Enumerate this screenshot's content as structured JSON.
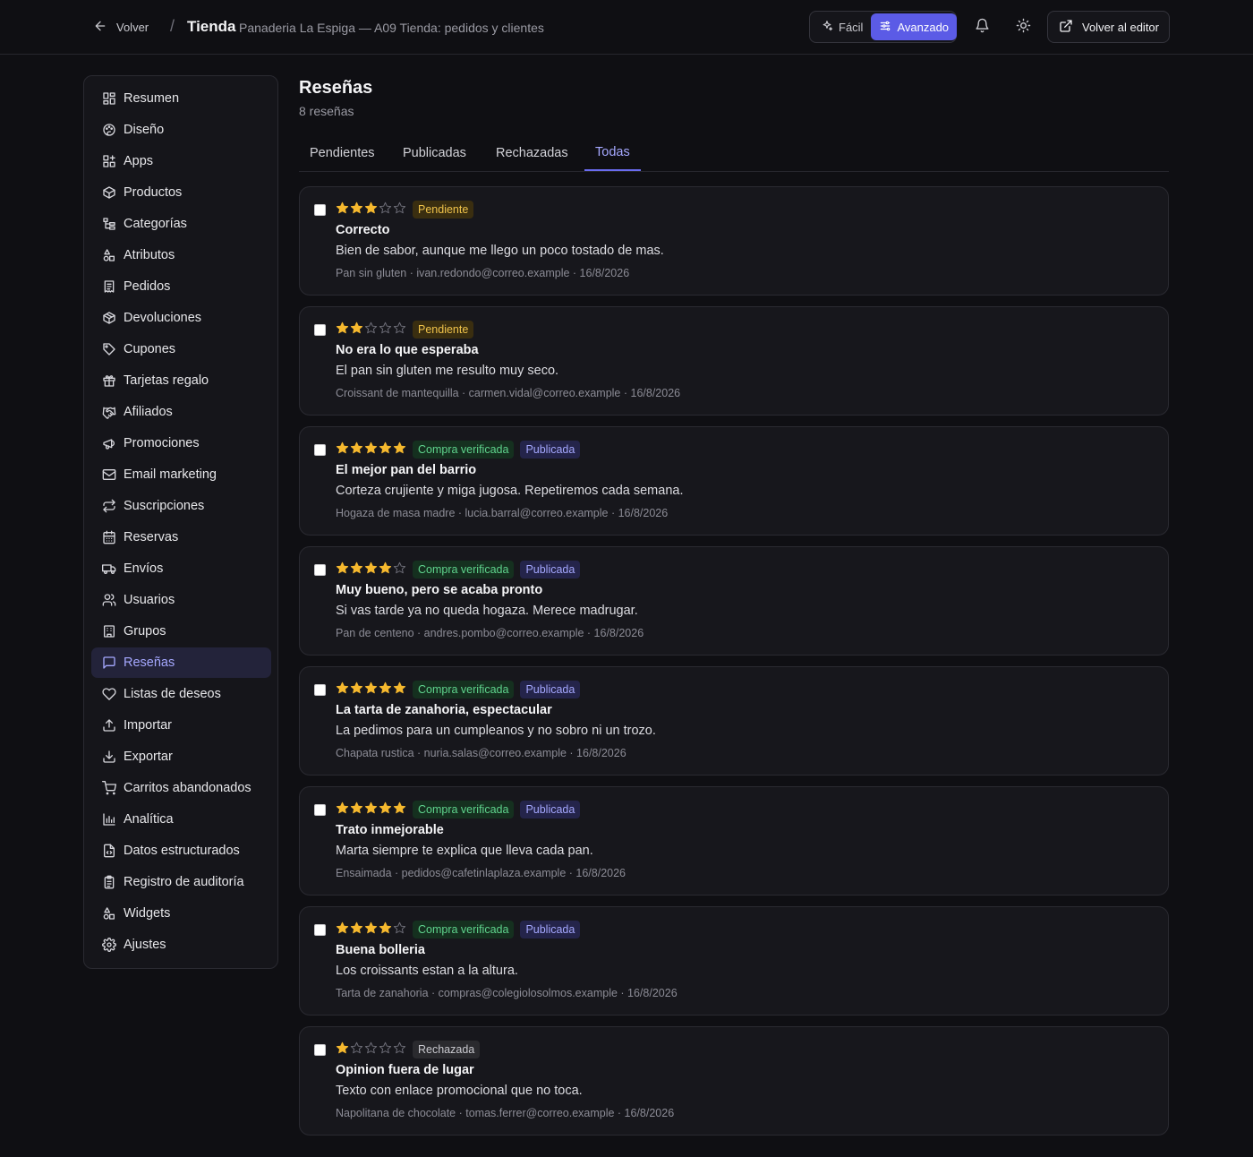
{
  "header": {
    "back_label": "Volver",
    "separator": "/",
    "title": "Tienda",
    "subtitle": "Panaderia La Espiga — A09 Tienda: pedidos y clientes",
    "mode_easy": "Fácil",
    "mode_advanced": "Avanzado",
    "editor_label": "Volver al editor"
  },
  "sidebar": {
    "items": [
      {
        "label": "Resumen",
        "icon": "grid-icon"
      },
      {
        "label": "Diseño",
        "icon": "palette-icon"
      },
      {
        "label": "Apps",
        "icon": "apps-icon"
      },
      {
        "label": "Productos",
        "icon": "box-icon"
      },
      {
        "label": "Categorías",
        "icon": "tree-icon"
      },
      {
        "label": "Atributos",
        "icon": "shapes-icon"
      },
      {
        "label": "Pedidos",
        "icon": "receipt-icon"
      },
      {
        "label": "Devoluciones",
        "icon": "box-return-icon"
      },
      {
        "label": "Cupones",
        "icon": "tag-icon"
      },
      {
        "label": "Tarjetas regalo",
        "icon": "gift-icon"
      },
      {
        "label": "Afiliados",
        "icon": "handshake-icon"
      },
      {
        "label": "Promociones",
        "icon": "megaphone-icon"
      },
      {
        "label": "Email marketing",
        "icon": "mail-icon"
      },
      {
        "label": "Suscripciones",
        "icon": "repeat-icon"
      },
      {
        "label": "Reservas",
        "icon": "calendar-icon"
      },
      {
        "label": "Envíos",
        "icon": "truck-icon"
      },
      {
        "label": "Usuarios",
        "icon": "users-icon"
      },
      {
        "label": "Grupos",
        "icon": "building-icon"
      },
      {
        "label": "Reseñas",
        "icon": "message-icon",
        "active": true
      },
      {
        "label": "Listas de deseos",
        "icon": "heart-icon"
      },
      {
        "label": "Importar",
        "icon": "upload-icon"
      },
      {
        "label": "Exportar",
        "icon": "download-icon"
      },
      {
        "label": "Carritos abandonados",
        "icon": "cart-icon"
      },
      {
        "label": "Analítica",
        "icon": "bar-chart-icon"
      },
      {
        "label": "Datos estructurados",
        "icon": "file-code-icon"
      },
      {
        "label": "Registro de auditoría",
        "icon": "clipboard-icon"
      },
      {
        "label": "Widgets",
        "icon": "shapes-icon"
      },
      {
        "label": "Ajustes",
        "icon": "gear-icon"
      }
    ]
  },
  "main": {
    "title": "Reseñas",
    "count": "8 reseñas",
    "tabs": [
      {
        "label": "Pendientes"
      },
      {
        "label": "Publicadas"
      },
      {
        "label": "Rechazadas"
      },
      {
        "label": "Todas",
        "active": true
      }
    ]
  },
  "reviews": [
    {
      "rating": 3,
      "badges": [
        {
          "label": "Pendiente",
          "kind": "pend"
        }
      ],
      "title": "Correcto",
      "body": "Bien de sabor, aunque me llego un poco tostado de mas.",
      "meta": "Pan sin gluten · ivan.redondo@correo.example · 16/8/2026"
    },
    {
      "rating": 2,
      "badges": [
        {
          "label": "Pendiente",
          "kind": "pend"
        }
      ],
      "title": "No era lo que esperaba",
      "body": "El pan sin gluten me resulto muy seco.",
      "meta": "Croissant de mantequilla · carmen.vidal@correo.example · 16/8/2026"
    },
    {
      "rating": 5,
      "badges": [
        {
          "label": "Compra verificada",
          "kind": "verif"
        },
        {
          "label": "Publicada",
          "kind": "pub"
        }
      ],
      "title": "El mejor pan del barrio",
      "body": "Corteza crujiente y miga jugosa. Repetiremos cada semana.",
      "meta": "Hogaza de masa madre · lucia.barral@correo.example · 16/8/2026"
    },
    {
      "rating": 4,
      "badges": [
        {
          "label": "Compra verificada",
          "kind": "verif"
        },
        {
          "label": "Publicada",
          "kind": "pub"
        }
      ],
      "title": "Muy bueno, pero se acaba pronto",
      "body": "Si vas tarde ya no queda hogaza. Merece madrugar.",
      "meta": "Pan de centeno · andres.pombo@correo.example · 16/8/2026"
    },
    {
      "rating": 5,
      "badges": [
        {
          "label": "Compra verificada",
          "kind": "verif"
        },
        {
          "label": "Publicada",
          "kind": "pub"
        }
      ],
      "title": "La tarta de zanahoria, espectacular",
      "body": "La pedimos para un cumpleanos y no sobro ni un trozo.",
      "meta": "Chapata rustica · nuria.salas@correo.example · 16/8/2026"
    },
    {
      "rating": 5,
      "badges": [
        {
          "label": "Compra verificada",
          "kind": "verif"
        },
        {
          "label": "Publicada",
          "kind": "pub"
        }
      ],
      "title": "Trato inmejorable",
      "body": "Marta siempre te explica que lleva cada pan.",
      "meta": "Ensaimada · pedidos@cafetinlaplaza.example · 16/8/2026"
    },
    {
      "rating": 4,
      "badges": [
        {
          "label": "Compra verificada",
          "kind": "verif"
        },
        {
          "label": "Publicada",
          "kind": "pub"
        }
      ],
      "title": "Buena bolleria",
      "body": "Los croissants estan a la altura.",
      "meta": "Tarta de zanahoria · compras@colegiolosolmos.example · 16/8/2026"
    },
    {
      "rating": 1,
      "badges": [
        {
          "label": "Rechazada",
          "kind": "rej"
        }
      ],
      "title": "Opinion fuera de lugar",
      "body": "Texto con enlace promocional que no toca.",
      "meta": "Napolitana de chocolate · tomas.ferrer@correo.example · 16/8/2026"
    }
  ],
  "colors": {
    "accent": "#5b5be6",
    "star_filled": "#f5b82e",
    "star_empty": "#6e6e78"
  }
}
